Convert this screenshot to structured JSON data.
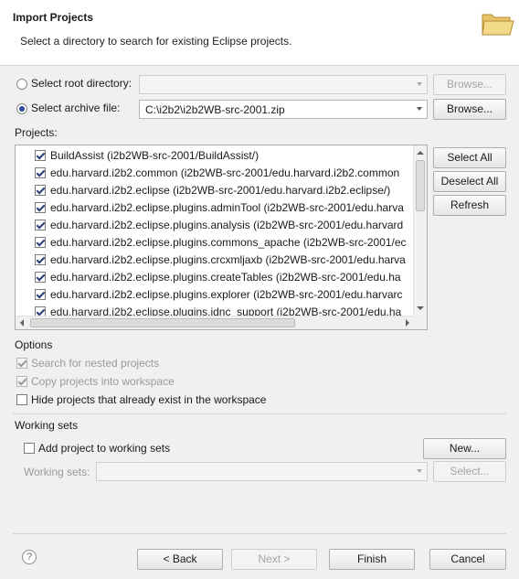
{
  "header": {
    "title": "Import Projects",
    "description": "Select a directory to search for existing Eclipse projects.",
    "icon": "folder-icon"
  },
  "source": {
    "root_label": "Select root directory:",
    "root_value": "",
    "archive_label": "Select archive file:",
    "archive_value": "C:\\i2b2\\i2b2WB-src-2001.zip",
    "browse_label": "Browse..."
  },
  "projects": {
    "label": "Projects:",
    "items": [
      "BuildAssist (i2b2WB-src-2001/BuildAssist/)",
      "edu.harvard.i2b2.common (i2b2WB-src-2001/edu.harvard.i2b2.common",
      "edu.harvard.i2b2.eclipse (i2b2WB-src-2001/edu.harvard.i2b2.eclipse/)",
      "edu.harvard.i2b2.eclipse.plugins.adminTool (i2b2WB-src-2001/edu.harva",
      "edu.harvard.i2b2.eclipse.plugins.analysis (i2b2WB-src-2001/edu.harvard",
      "edu.harvard.i2b2.eclipse.plugins.commons_apache (i2b2WB-src-2001/ec",
      "edu.harvard.i2b2.eclipse.plugins.crcxmljaxb (i2b2WB-src-2001/edu.harva",
      "edu.harvard.i2b2.eclipse.plugins.createTables (i2b2WB-src-2001/edu.ha",
      "edu.harvard.i2b2.eclipse.plugins.explorer (i2b2WB-src-2001/edu.harvarc",
      "edu.harvard.i2b2.eclipse.plugins.jdnc_support (i2b2WB-src-2001/edu.ha"
    ],
    "select_all": "Select All",
    "deselect_all": "Deselect All",
    "refresh": "Refresh"
  },
  "options": {
    "label": "Options",
    "nested": "Search for nested projects",
    "copy": "Copy projects into workspace",
    "hide": "Hide projects that already exist in the workspace"
  },
  "working_sets": {
    "label": "Working sets",
    "add": "Add project to working sets",
    "new_label": "New...",
    "sets_label": "Working sets:",
    "select_label": "Select..."
  },
  "footer": {
    "help": "?",
    "back": "< Back",
    "next": "Next >",
    "finish": "Finish",
    "cancel": "Cancel"
  }
}
